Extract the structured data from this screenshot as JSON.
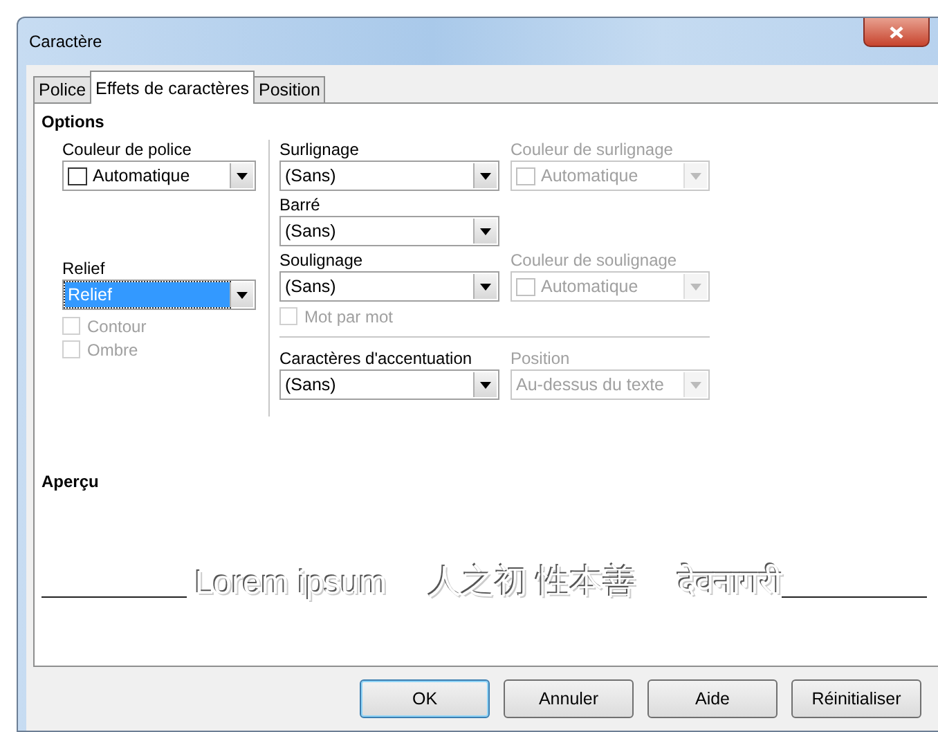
{
  "window": {
    "title": "Caractère"
  },
  "tabs": [
    {
      "label": "Police",
      "selected": false
    },
    {
      "label": "Effets de caractères",
      "selected": true
    },
    {
      "label": "Position",
      "selected": false
    }
  ],
  "options": {
    "title": "Options",
    "font_color": {
      "label": "Couleur de police",
      "value": "Automatique",
      "disabled": false,
      "swatch": true
    },
    "relief": {
      "label": "Relief",
      "value": "Relief",
      "disabled": false,
      "focused": true
    },
    "checkboxes": [
      {
        "label": "Contour",
        "checked": false,
        "disabled": true
      },
      {
        "label": "Ombre",
        "checked": false,
        "disabled": true
      }
    ],
    "highlighting": {
      "label": "Surlignage",
      "value": "(Sans)",
      "disabled": false
    },
    "highlight_color": {
      "label": "Couleur de surlignage",
      "value": "Automatique",
      "disabled": true,
      "swatch": true
    },
    "strikethrough": {
      "label": "Barré",
      "value": "(Sans)",
      "disabled": false
    },
    "underline": {
      "label": "Soulignage",
      "value": "(Sans)",
      "disabled": false
    },
    "underline_color": {
      "label": "Couleur de soulignage",
      "value": "Automatique",
      "disabled": true,
      "swatch": true
    },
    "word_by_word": {
      "label": "Mot par mot",
      "checked": false,
      "disabled": true
    },
    "emphasis": {
      "label": "Caractères d'accentuation",
      "value": "(Sans)",
      "disabled": false
    },
    "position": {
      "label": "Position",
      "value": "Au-dessus du texte",
      "disabled": true
    }
  },
  "preview": {
    "title": "Aperçu",
    "texts": [
      "Lorem ipsum",
      "人之初 性本善",
      "देवनागरी"
    ]
  },
  "buttons": [
    {
      "label": "OK",
      "default": true
    },
    {
      "label": "Annuler",
      "default": false
    },
    {
      "label": "Aide",
      "default": false
    },
    {
      "label": "Réinitialiser",
      "default": false
    }
  ]
}
